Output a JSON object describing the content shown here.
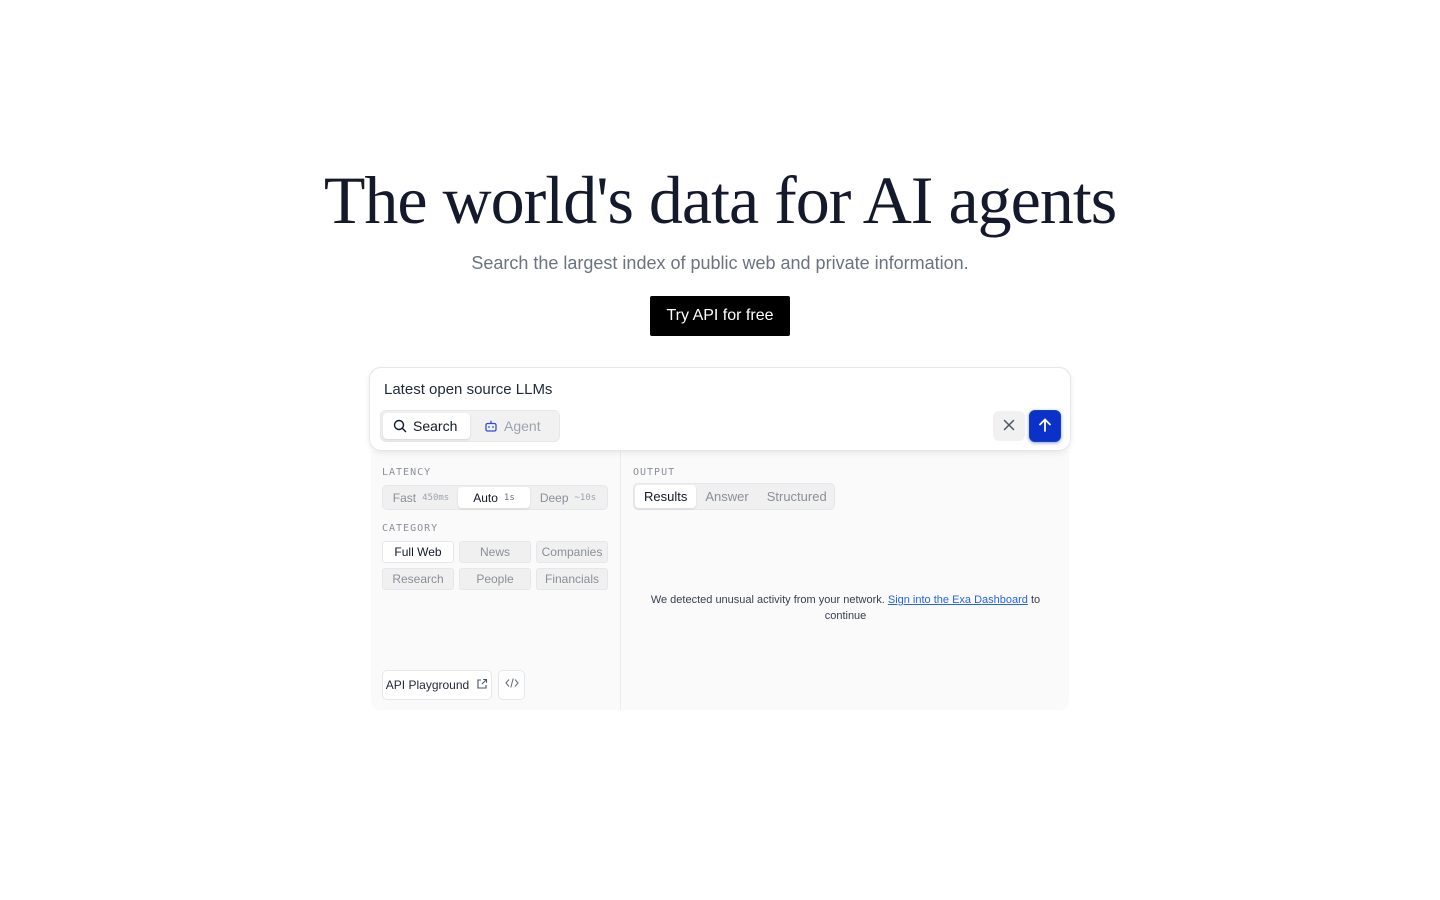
{
  "hero": {
    "title": "The world's data for AI agents",
    "subtitle": "Search the largest index of public web and private information.",
    "cta_label": "Try API for free"
  },
  "search": {
    "query": "Latest open source LLMs",
    "modes": [
      {
        "label": "Search",
        "icon": "search-icon",
        "active": true
      },
      {
        "label": "Agent",
        "icon": "robot-icon",
        "active": false
      }
    ],
    "clear_icon": "close-icon",
    "submit_icon": "arrow-up-icon",
    "submit_color": "#0a31c9"
  },
  "options": {
    "latency_label": "LATENCY",
    "latency": [
      {
        "label": "Fast",
        "tag": "450ms",
        "active": false
      },
      {
        "label": "Auto",
        "tag": "1s",
        "active": true
      },
      {
        "label": "Deep",
        "tag": "~10s",
        "active": false
      }
    ],
    "category_label": "CATEGORY",
    "categories": [
      {
        "label": "Full Web",
        "active": true
      },
      {
        "label": "News",
        "active": false
      },
      {
        "label": "Companies",
        "active": false
      },
      {
        "label": "Research",
        "active": false
      },
      {
        "label": "People",
        "active": false
      },
      {
        "label": "Financials",
        "active": false
      }
    ],
    "playground_label": "API Playground",
    "playground_icon": "external-link-icon",
    "code_icon": "code-icon"
  },
  "output": {
    "label": "OUTPUT",
    "tabs": [
      {
        "label": "Results",
        "active": true
      },
      {
        "label": "Answer",
        "active": false
      },
      {
        "label": "Structured",
        "active": false
      }
    ],
    "notice_before": "We detected unusual activity from your network.",
    "notice_link": "Sign into the Exa Dashboard",
    "notice_after": "to continue",
    "link_color": "#2563eb"
  }
}
